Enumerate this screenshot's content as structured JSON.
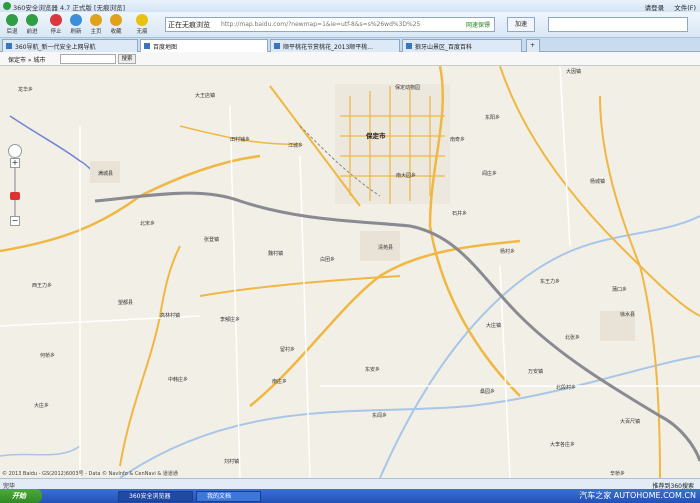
{
  "window": {
    "title": "360安全浏览器 4.7 正式版 [无痕浏览]",
    "menu": [
      "请登录",
      "文件(F)"
    ]
  },
  "toolbar": {
    "buttons": [
      {
        "label": "后退",
        "icon": "back-icon",
        "color": "#2f9e44"
      },
      {
        "label": "前进",
        "icon": "forward-icon",
        "color": "#2f9e44"
      },
      {
        "label": "停止",
        "icon": "stop-icon",
        "color": "#d9363e"
      },
      {
        "label": "刷新",
        "icon": "refresh-icon",
        "color": "#3a8fd8"
      },
      {
        "label": "主页",
        "icon": "home-icon",
        "color": "#e0a21a"
      },
      {
        "label": "收藏",
        "icon": "favorites-icon",
        "color": "#e0a21a"
      },
      {
        "label": "无痕",
        "icon": "incognito-icon",
        "color": "#e8c20e"
      }
    ],
    "address_prefix": "正在无痕浏览",
    "address_value": "http://map.baidu.com/?newmap=1&ie=utf-8&s=s%26wd%3D%25E4%25BF%259D%25E5%25AE%259A%25E5%25B8%2582",
    "speed_label": "网速保镖",
    "go_label": "加速",
    "search_value": ""
  },
  "tabs": [
    {
      "label": "360导航_新一代安全上网导航",
      "active": false
    },
    {
      "label": "百度地图",
      "active": true
    },
    {
      "label": "顺平桃花节赏桃花_2013顺平桃...",
      "active": false
    },
    {
      "label": "狼牙山景区_百度百科",
      "active": false
    }
  ],
  "mapbar": {
    "city": "保定市 » 城市",
    "search_placeholder": "",
    "search_button": "搜索"
  },
  "map": {
    "main_city": "保定市",
    "labels": [
      "大因镇",
      "保定动物园",
      "保定市",
      "大王店镇",
      "江城乡",
      "南大园乡",
      "田村铺乡",
      "东阳乡",
      "阎庄乡",
      "南奇乡",
      "石井乡",
      "大庄镇",
      "杨村乡",
      "白团乡",
      "东王力乡",
      "高林村镇",
      "大李各庄乡",
      "北张乡",
      "李郁庄乡",
      "万安镇",
      "北段村乡",
      "大百尺镇",
      "辛桥乡",
      "中韩庄乡",
      "清苑县",
      "望都县",
      "满城县",
      "徐水县",
      "蒲口乡",
      "南庄乡",
      "何桥乡",
      "魏村镇",
      "杨城镇",
      "桑园乡",
      "龙华乡",
      "北宋乡",
      "张登镇",
      "留村乡",
      "大庄乡",
      "东安乡",
      "西王力乡",
      "东闾乡",
      "刘村镇"
    ],
    "copyright": "© 2013 Baidu - GS(2012)6003号 - Data © NavInfo & CenNavi & 道道通",
    "zoom_level": 0.5
  },
  "status": {
    "left": "完毕",
    "right": "推荐到360搜索"
  },
  "taskbar": {
    "start": "开始",
    "tasks": [
      {
        "label": "360安全浏览器",
        "active": true
      },
      {
        "label": "我的文档",
        "active": false
      }
    ]
  },
  "watermark": "汽车之家  AUTOHOME.COM.CN"
}
